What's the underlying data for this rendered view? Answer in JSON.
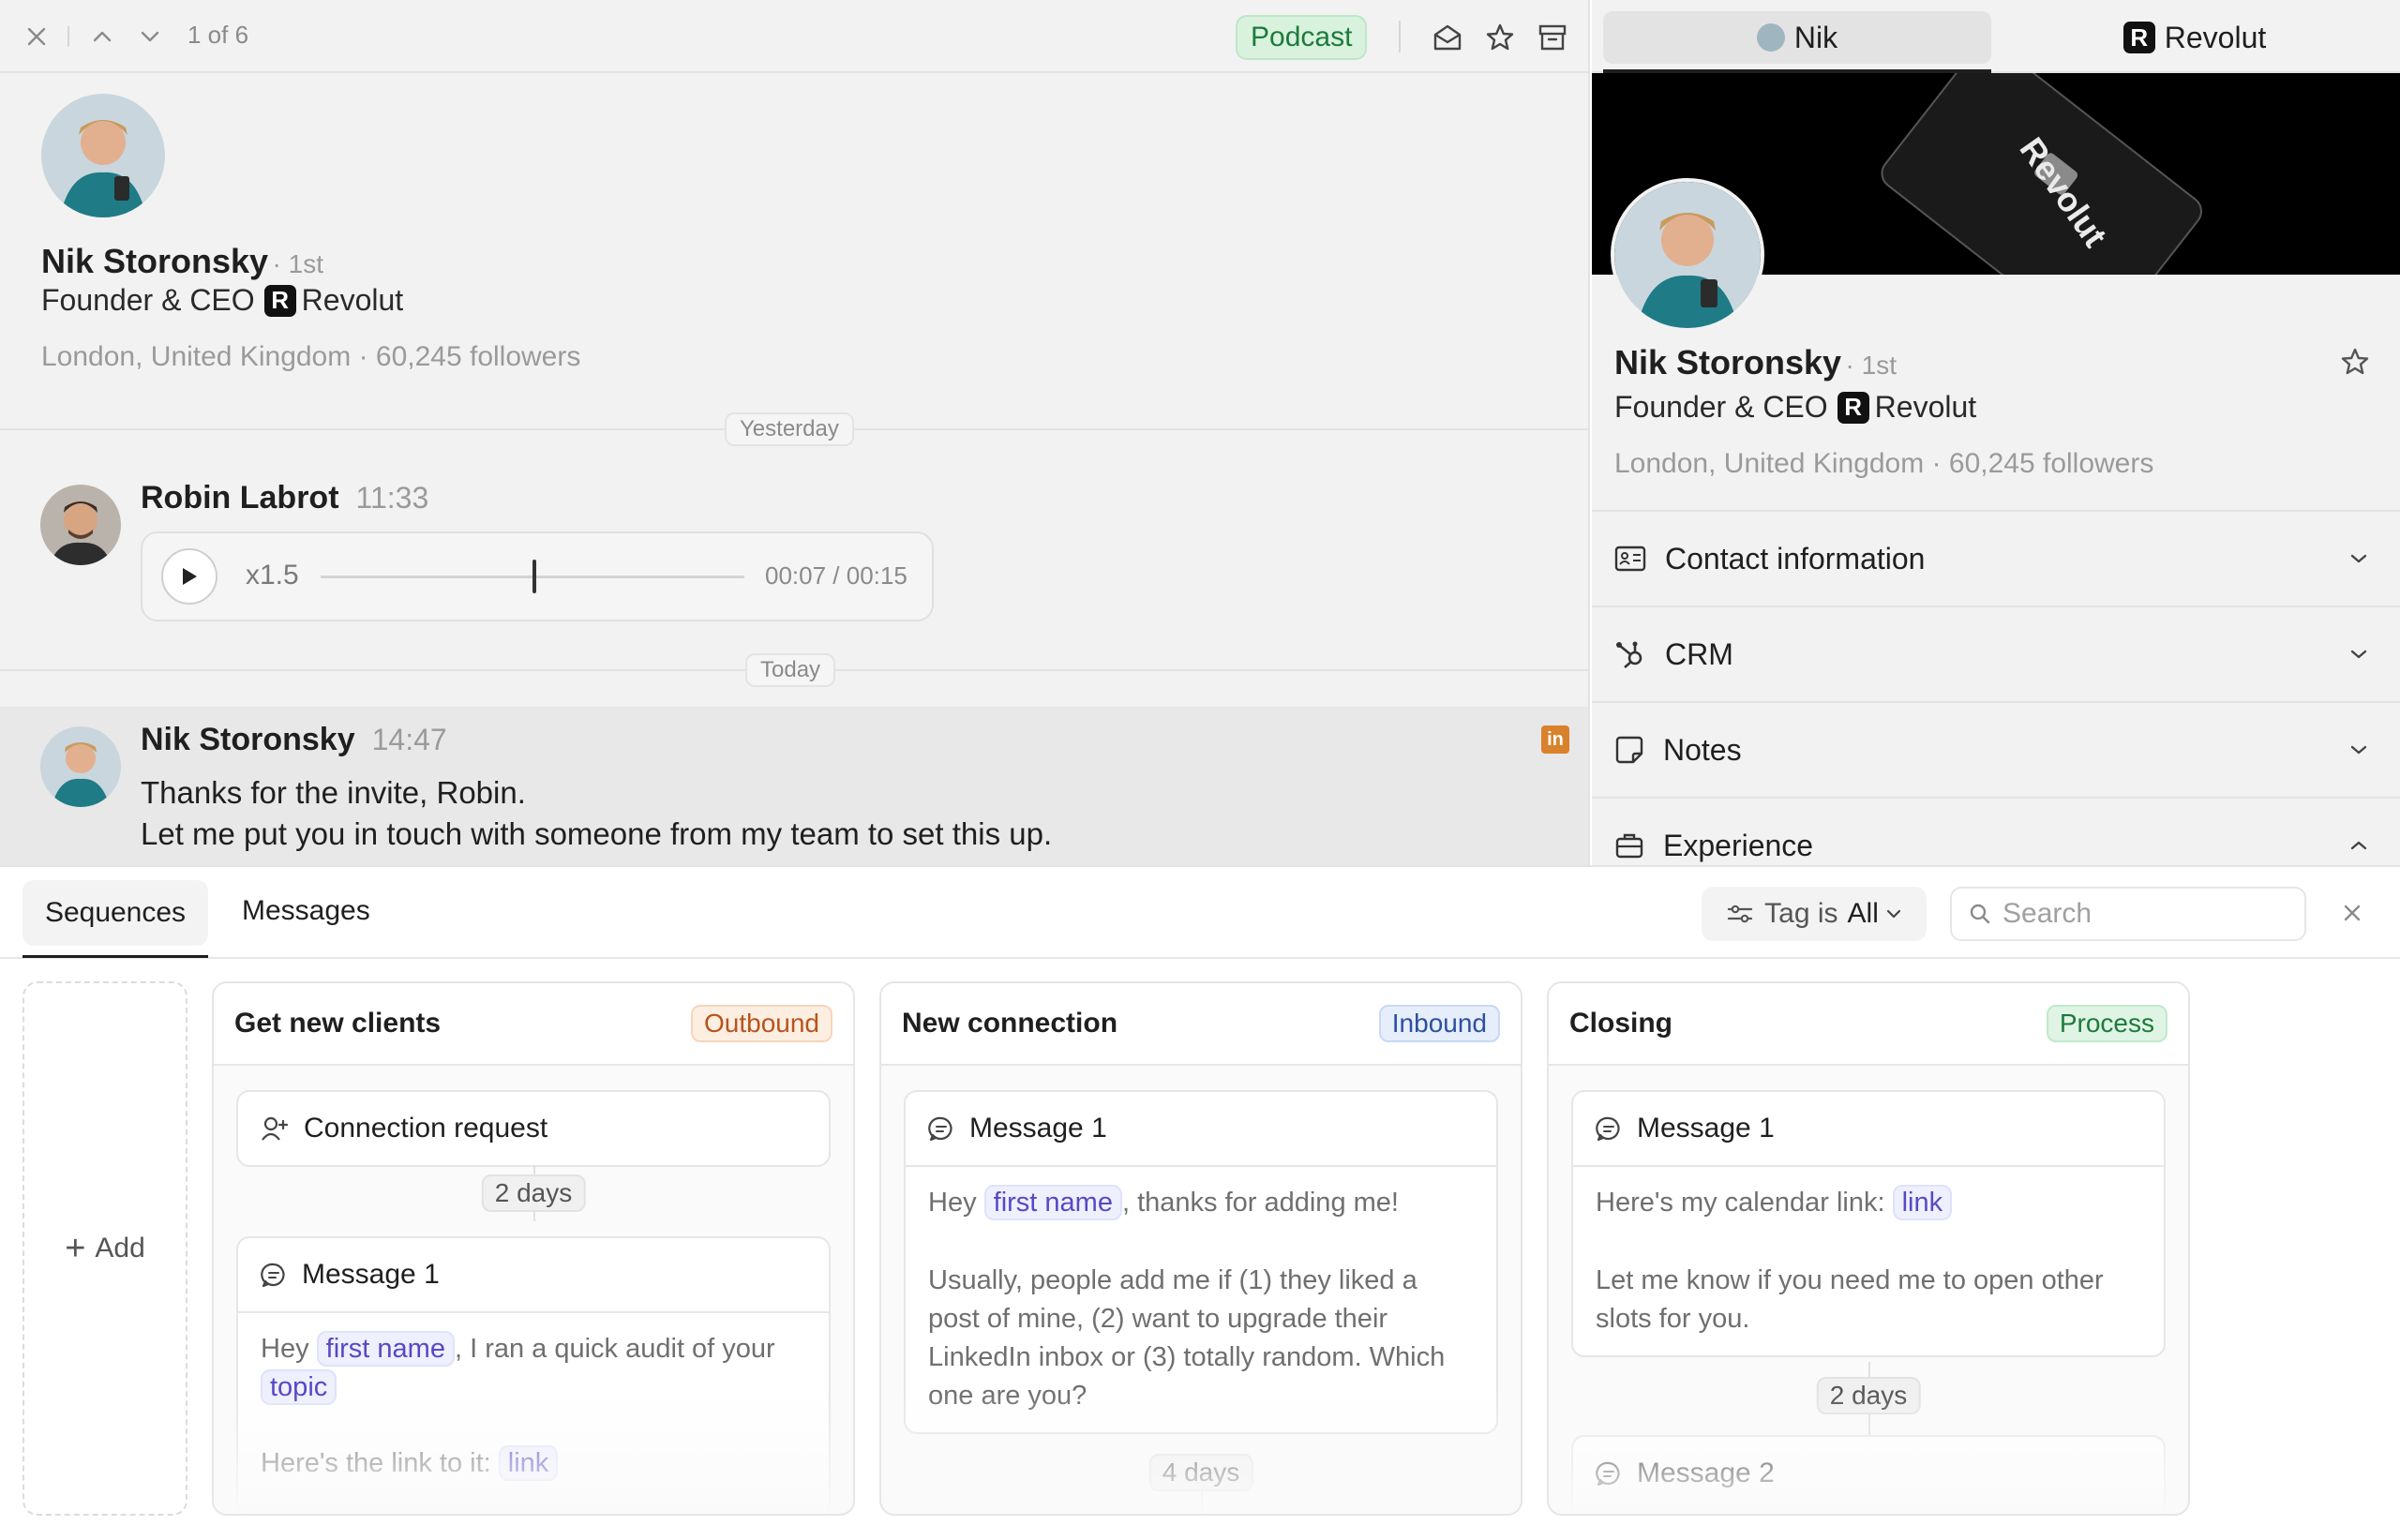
{
  "topbar": {
    "counter": "1 of 6",
    "tag_label": "Podcast"
  },
  "profile": {
    "name": "Nik Storonsky",
    "degree": "· 1st",
    "title": "Founder & CEO",
    "company": "Revolut",
    "company_logo_letter": "R",
    "location_line": "London, United Kingdom · 60,245 followers"
  },
  "conversation": {
    "day_yesterday": "Yesterday",
    "day_today": "Today",
    "messages": [
      {
        "sender": "Robin Labrot",
        "time": "11:33",
        "audio": {
          "speed": "x1.5",
          "time": "00:07 / 00:15",
          "progress": 0.5
        }
      },
      {
        "sender": "Nik Storonsky",
        "time": "14:47",
        "lines": [
          "Thanks for the invite, Robin.",
          "Let me put you in touch with someone from my team to set this up."
        ],
        "source_icon": "linkedin-icon"
      }
    ]
  },
  "right_panel": {
    "tabs": [
      {
        "label": "Nik"
      },
      {
        "label": "Revolut"
      }
    ],
    "banner_text": "Revolut",
    "sections": [
      {
        "label": "Contact information",
        "state": "collapsed"
      },
      {
        "label": "CRM",
        "state": "collapsed"
      },
      {
        "label": "Notes",
        "state": "collapsed"
      },
      {
        "label": "Experience",
        "state": "expanded"
      }
    ]
  },
  "bottom": {
    "tabs": [
      {
        "label": "Sequences",
        "active": true
      },
      {
        "label": "Messages",
        "active": false
      }
    ],
    "filter": {
      "label": "Tag is",
      "value": "All"
    },
    "search_placeholder": "Search",
    "add_label": "Add",
    "columns": [
      {
        "title": "Get new clients",
        "badge": "Outbound",
        "steps": {
          "first": "Connection request",
          "delay1": "2 days",
          "second": "Message 1",
          "body": {
            "pre": "Hey ",
            "var1": "first name",
            "mid": ", I ran a quick audit of your ",
            "var2": "topic",
            "line3_pre": "Here's the link to it: ",
            "var3": "link"
          }
        }
      },
      {
        "title": "New connection",
        "badge": "Inbound",
        "steps": {
          "first": "Message 1",
          "body": {
            "pre": "Hey ",
            "var1": "first name",
            "post": ", thanks for adding me!",
            "para2": "Usually, people add me if (1) they liked a post of mine, (2) want to upgrade their LinkedIn inbox or (3) totally random. Which one are you?"
          },
          "delay1": "4 days"
        }
      },
      {
        "title": "Closing",
        "badge": "Process",
        "steps": {
          "first": "Message 1",
          "body": {
            "pre": "Here's my calendar link: ",
            "var1": "link",
            "para2": "Let me know if you need me to open other slots for you."
          },
          "delay1": "2 days",
          "second": "Message 2"
        }
      }
    ]
  },
  "colors": {
    "accent_green": "#1d7a3b",
    "outbound": "#b8541a",
    "inbound": "#2d4fa0",
    "variable": "#5b46c6",
    "linkedin_orange": "#d9822b"
  }
}
